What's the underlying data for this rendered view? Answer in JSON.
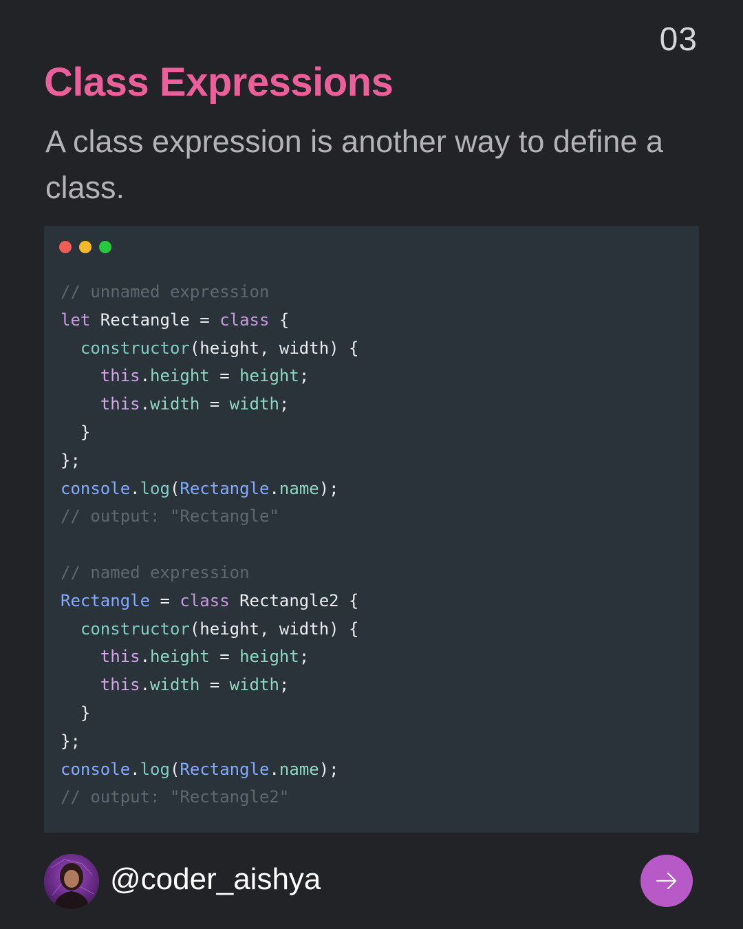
{
  "page_number": "03",
  "title": "Class Expressions",
  "subtitle": "A class expression is another way to define a class.",
  "code_window": {
    "controls": [
      "close",
      "minimize",
      "maximize"
    ],
    "lines": [
      [
        {
          "t": "// unnamed expression",
          "c": "comment"
        }
      ],
      [
        {
          "t": "let",
          "c": "keyword"
        },
        {
          "t": " Rectangle = ",
          "c": "text"
        },
        {
          "t": "class",
          "c": "keyword"
        },
        {
          "t": " {",
          "c": "text"
        }
      ],
      [
        {
          "t": "  ",
          "c": "text"
        },
        {
          "t": "constructor",
          "c": "func"
        },
        {
          "t": "(height, width) {",
          "c": "text"
        }
      ],
      [
        {
          "t": "    ",
          "c": "text"
        },
        {
          "t": "this",
          "c": "this"
        },
        {
          "t": ".",
          "c": "text"
        },
        {
          "t": "height",
          "c": "prop"
        },
        {
          "t": " = ",
          "c": "text"
        },
        {
          "t": "height",
          "c": "prop"
        },
        {
          "t": ";",
          "c": "text"
        }
      ],
      [
        {
          "t": "    ",
          "c": "text"
        },
        {
          "t": "this",
          "c": "this"
        },
        {
          "t": ".",
          "c": "text"
        },
        {
          "t": "width",
          "c": "prop"
        },
        {
          "t": " = ",
          "c": "text"
        },
        {
          "t": "width",
          "c": "prop"
        },
        {
          "t": ";",
          "c": "text"
        }
      ],
      [
        {
          "t": "  }",
          "c": "text"
        }
      ],
      [
        {
          "t": "};",
          "c": "text"
        }
      ],
      [
        {
          "t": "console",
          "c": "obj"
        },
        {
          "t": ".",
          "c": "text"
        },
        {
          "t": "log",
          "c": "func"
        },
        {
          "t": "(",
          "c": "text"
        },
        {
          "t": "Rectangle",
          "c": "obj"
        },
        {
          "t": ".",
          "c": "text"
        },
        {
          "t": "name",
          "c": "prop"
        },
        {
          "t": ");",
          "c": "text"
        }
      ],
      [
        {
          "t": "// output: \"Rectangle\"",
          "c": "comment"
        }
      ],
      [],
      [
        {
          "t": "// named expression",
          "c": "comment"
        }
      ],
      [
        {
          "t": "Rectangle",
          "c": "obj"
        },
        {
          "t": " = ",
          "c": "text"
        },
        {
          "t": "class",
          "c": "keyword"
        },
        {
          "t": " Rectangle2 {",
          "c": "text"
        }
      ],
      [
        {
          "t": "  ",
          "c": "text"
        },
        {
          "t": "constructor",
          "c": "func"
        },
        {
          "t": "(height, width) {",
          "c": "text"
        }
      ],
      [
        {
          "t": "    ",
          "c": "text"
        },
        {
          "t": "this",
          "c": "this"
        },
        {
          "t": ".",
          "c": "text"
        },
        {
          "t": "height",
          "c": "prop"
        },
        {
          "t": " = ",
          "c": "text"
        },
        {
          "t": "height",
          "c": "prop"
        },
        {
          "t": ";",
          "c": "text"
        }
      ],
      [
        {
          "t": "    ",
          "c": "text"
        },
        {
          "t": "this",
          "c": "this"
        },
        {
          "t": ".",
          "c": "text"
        },
        {
          "t": "width",
          "c": "prop"
        },
        {
          "t": " = ",
          "c": "text"
        },
        {
          "t": "width",
          "c": "prop"
        },
        {
          "t": ";",
          "c": "text"
        }
      ],
      [
        {
          "t": "  }",
          "c": "text"
        }
      ],
      [
        {
          "t": "};",
          "c": "text"
        }
      ],
      [
        {
          "t": "console",
          "c": "obj"
        },
        {
          "t": ".",
          "c": "text"
        },
        {
          "t": "log",
          "c": "func"
        },
        {
          "t": "(",
          "c": "text"
        },
        {
          "t": "Rectangle",
          "c": "obj"
        },
        {
          "t": ".",
          "c": "text"
        },
        {
          "t": "name",
          "c": "prop"
        },
        {
          "t": ");",
          "c": "text"
        }
      ],
      [
        {
          "t": "// output: \"Rectangle2\"",
          "c": "comment"
        }
      ]
    ]
  },
  "footer": {
    "handle": "@coder_aishya",
    "avatar_icon": "avatar-photo",
    "next_icon": "arrow-right-icon"
  },
  "colors": {
    "background": "#222327",
    "title": "#e9609b",
    "code_background": "#2a323a",
    "next_button": "#b75ac7"
  }
}
